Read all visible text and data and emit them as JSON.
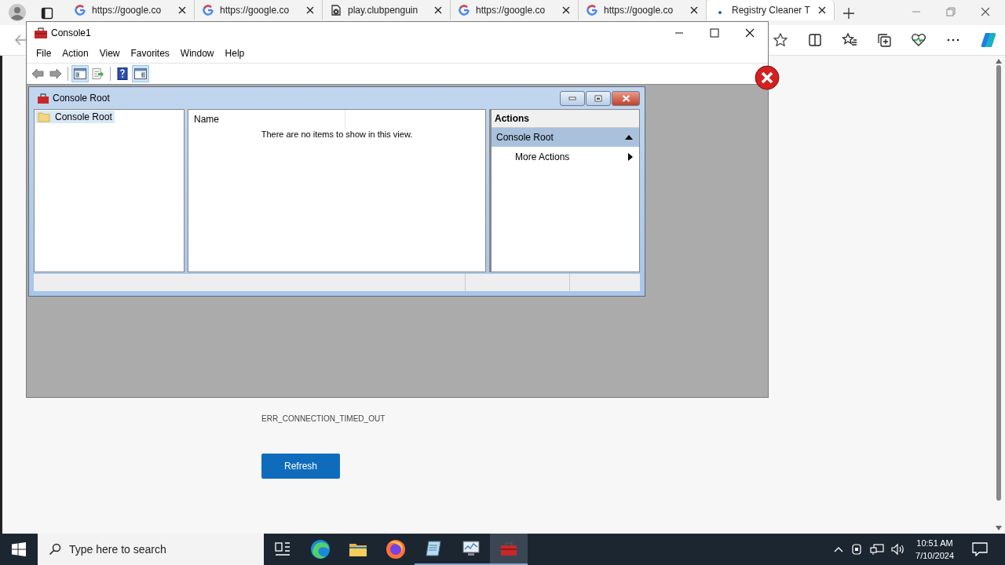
{
  "browser": {
    "tabs": [
      {
        "label": "https://google.co",
        "kind": "google",
        "selected": false
      },
      {
        "label": "https://google.co",
        "kind": "google",
        "selected": false
      },
      {
        "label": "play.clubpenguin",
        "kind": "page",
        "selected": false
      },
      {
        "label": "https://google.co",
        "kind": "google",
        "selected": false
      },
      {
        "label": "https://google.co",
        "kind": "google",
        "selected": false
      },
      {
        "label": "Registry Cleaner T",
        "kind": "loading",
        "selected": true
      }
    ],
    "page": {
      "error_code": "ERR_CONNECTION_TIMED_OUT",
      "button": "Refresh"
    }
  },
  "mmc": {
    "title": "Console1",
    "menu": [
      "File",
      "Action",
      "View",
      "Favorites",
      "Window",
      "Help"
    ],
    "toolbar": [
      {
        "kind": "back",
        "pressed": false
      },
      {
        "kind": "forward",
        "pressed": false
      },
      {
        "kind": "sep"
      },
      {
        "kind": "tree",
        "pressed": true
      },
      {
        "kind": "export",
        "pressed": false
      },
      {
        "kind": "sep"
      },
      {
        "kind": "help",
        "pressed": false
      },
      {
        "kind": "actionpane",
        "pressed": true
      }
    ],
    "child": {
      "title": "Console Root",
      "tree": [
        {
          "label": "Console Root",
          "selected": true
        }
      ],
      "columns": [
        "Name"
      ],
      "empty_message": "There are no items to show in this view.",
      "actions": {
        "title": "Actions",
        "section": "Console Root",
        "items": [
          "More Actions"
        ]
      }
    }
  },
  "taskbar": {
    "search_placeholder": "Type here to search",
    "time": "10:51 AM",
    "date": "7/10/2024",
    "apps": [
      {
        "kind": "taskview",
        "running": false,
        "selected": false
      },
      {
        "kind": "edge",
        "running": false,
        "selected": false
      },
      {
        "kind": "explorer",
        "running": false,
        "selected": false
      },
      {
        "kind": "firefox",
        "running": false,
        "selected": false
      },
      {
        "kind": "notepad",
        "running": true,
        "selected": false
      },
      {
        "kind": "monitor",
        "running": true,
        "selected": false
      },
      {
        "kind": "toolbox",
        "running": true,
        "selected": true
      }
    ]
  }
}
